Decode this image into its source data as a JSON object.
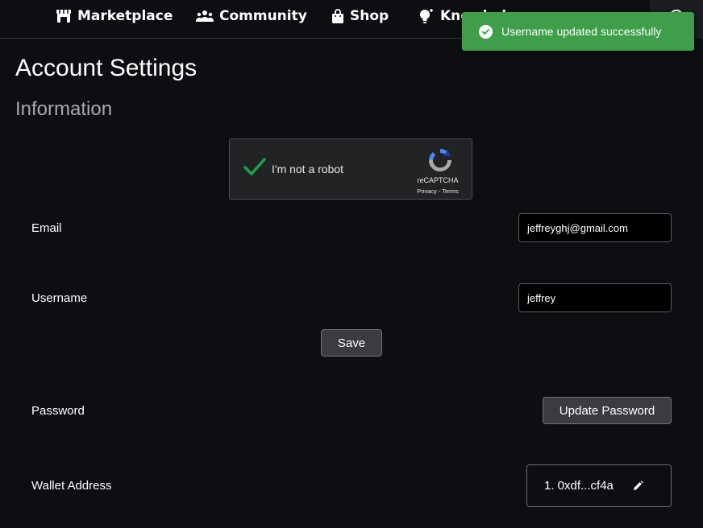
{
  "nav": {
    "items": [
      {
        "label": "Marketplace",
        "icon": "store-icon"
      },
      {
        "label": "Community",
        "icon": "people-icon"
      },
      {
        "label": "Shop",
        "icon": "shopping-bag-icon"
      },
      {
        "label": "Knowledge",
        "icon": "lightbulb-icon"
      }
    ]
  },
  "toast": {
    "message": "Username updated successfully",
    "color": "#3f9e4a",
    "icon": "check-circle-icon"
  },
  "page": {
    "title": "Account Settings",
    "section": "Information"
  },
  "recaptcha": {
    "label": "I'm not a robot",
    "brand": "reCAPTCHA",
    "privacy": "Privacy",
    "separator": " - ",
    "terms": "Terms",
    "checked": true
  },
  "form": {
    "email_label": "Email",
    "email_value": "jeffreyghj@gmail.com",
    "username_label": "Username",
    "username_value": "jeffrey",
    "save_label": "Save",
    "password_label": "Password",
    "update_password_label": "Update Password",
    "wallet_label": "Wallet Address",
    "wallet_value": "1. 0xdf...cf4a",
    "wallet_edit_icon": "pencil-icon"
  }
}
